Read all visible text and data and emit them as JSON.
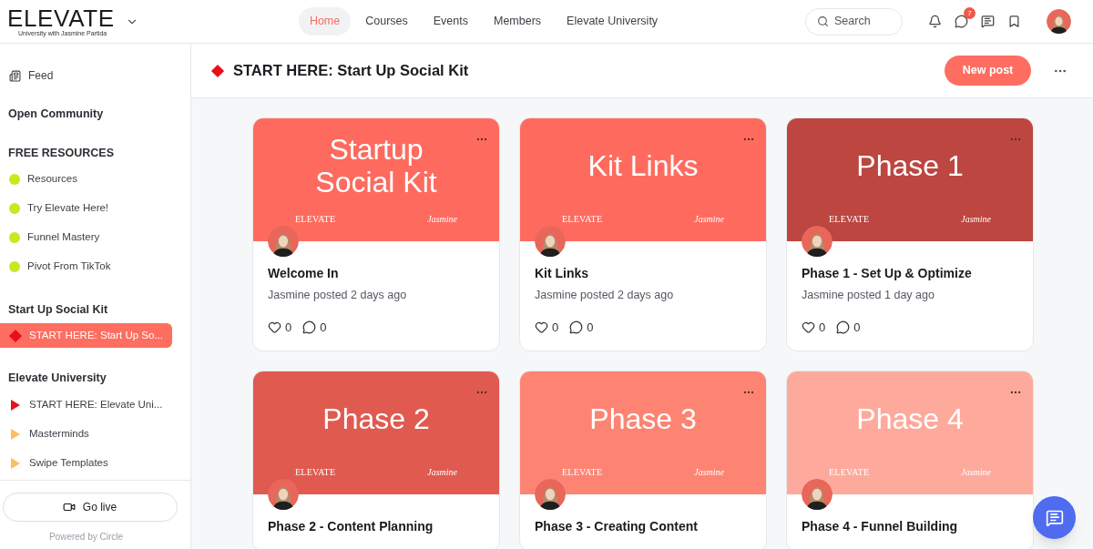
{
  "brand": {
    "name": "ELEVATE",
    "tagline": "University with Jasmine Partida"
  },
  "nav": [
    {
      "label": "Home",
      "selected": true
    },
    {
      "label": "Courses",
      "selected": false
    },
    {
      "label": "Events",
      "selected": false
    },
    {
      "label": "Members",
      "selected": false
    },
    {
      "label": "Elevate University",
      "selected": false
    }
  ],
  "search": {
    "placeholder": "Search"
  },
  "chat_badge": "7",
  "sidebar": {
    "feed": "Feed",
    "sections": [
      {
        "heading": "Open Community"
      },
      {
        "heading": "FREE RESOURCES",
        "items": [
          {
            "label": "Resources",
            "kind": "dot",
            "color": "#c5ea1f",
            "selected": false
          },
          {
            "label": "Try Elevate Here!",
            "kind": "dot",
            "color": "#c5ea1f",
            "selected": false
          },
          {
            "label": "Funnel Mastery",
            "kind": "dot",
            "color": "#c5ea1f",
            "selected": false
          },
          {
            "label": "Pivot From TikTok",
            "kind": "dot",
            "color": "#c5ea1f",
            "selected": false
          }
        ]
      },
      {
        "heading": "Start Up Social Kit",
        "items": [
          {
            "label": "START HERE: Start Up So...",
            "kind": "diamond",
            "color": "#e8101b",
            "selected": true
          }
        ]
      },
      {
        "heading": "Elevate University",
        "items": [
          {
            "label": "START HERE: Elevate Uni...",
            "kind": "triangle",
            "color": "#e8101b",
            "selected": false
          },
          {
            "label": "Masterminds",
            "kind": "triangle",
            "color": "#fbbf5e",
            "selected": false
          },
          {
            "label": "Swipe Templates",
            "kind": "triangle",
            "color": "#fbbf5e",
            "selected": false
          }
        ]
      }
    ],
    "go_live": "Go live",
    "powered_by": "Powered by Circle"
  },
  "space": {
    "title": "START HERE: Start Up Social Kit",
    "new_post": "New post"
  },
  "posts": [
    {
      "cover_title": "Startup Social Kit",
      "color": "#fe6b5e",
      "logo": "ELEVATE",
      "signature": "Jasmine",
      "title": "Welcome In",
      "meta": "Jasmine posted 2 days ago",
      "likes": "0",
      "comments": "0"
    },
    {
      "cover_title": "Kit Links",
      "color": "#fe6b5e",
      "logo": "ELEVATE",
      "signature": "Jasmine",
      "title": "Kit Links",
      "meta": "Jasmine posted 2 days ago",
      "likes": "0",
      "comments": "0"
    },
    {
      "cover_title": "Phase 1",
      "color": "#bd4640",
      "logo": "ELEVATE",
      "signature": "Jasmine",
      "title": "Phase 1 - Set Up & Optimize",
      "meta": "Jasmine posted 1 day ago",
      "likes": "0",
      "comments": "0"
    },
    {
      "cover_title": "Phase 2",
      "color": "#e05a50",
      "logo": "ELEVATE",
      "signature": "Jasmine",
      "title": "Phase 2 - Content Planning"
    },
    {
      "cover_title": "Phase 3",
      "color": "#fd8473",
      "logo": "ELEVATE",
      "signature": "Jasmine",
      "title": "Phase 3 - Creating Content"
    },
    {
      "cover_title": "Phase 4",
      "color": "#fdaa9d",
      "logo": "ELEVATE",
      "signature": "Jasmine",
      "title": "Phase 4 - Funnel Building"
    }
  ]
}
